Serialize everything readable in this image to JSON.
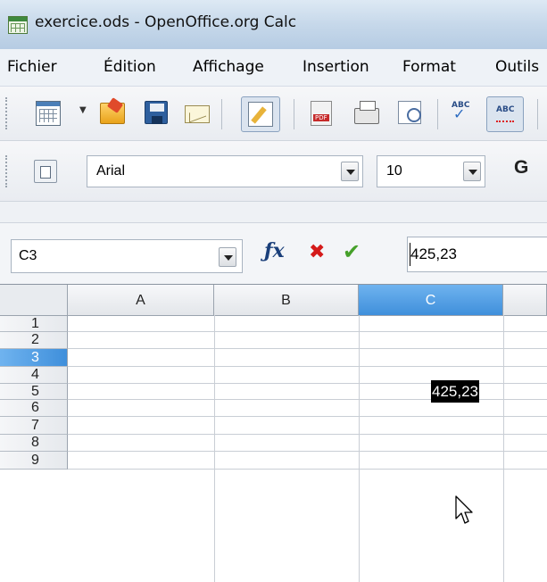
{
  "window": {
    "title": "exercice.ods - OpenOffice.org Calc"
  },
  "menu": [
    "Fichier",
    "Édition",
    "Affichage",
    "Insertion",
    "Format",
    "Outils"
  ],
  "formatting": {
    "font_name": "Arial",
    "font_size": "10",
    "bold_label": "G"
  },
  "formula_bar": {
    "name_box": "C3",
    "input": "425,23"
  },
  "sheet": {
    "columns": [
      "A",
      "B",
      "C"
    ],
    "rows": [
      "1",
      "2",
      "3",
      "4",
      "5",
      "6",
      "7",
      "8",
      "9"
    ],
    "selected_column": "C",
    "selected_row": "3",
    "cell_C3": "425,23"
  },
  "colors": {
    "selection_blue": "#3f8fdb",
    "cancel_red": "#d41a1a",
    "accept_green": "#45a02a"
  }
}
